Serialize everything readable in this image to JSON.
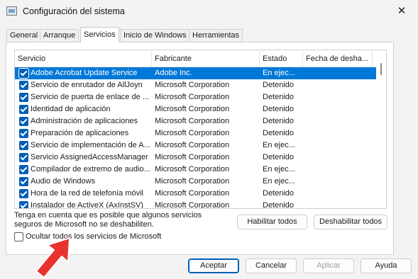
{
  "window": {
    "title": "Configuración del sistema",
    "close_glyph": "✕"
  },
  "tabs": [
    {
      "label": "General"
    },
    {
      "label": "Arranque"
    },
    {
      "label": "Servicios"
    },
    {
      "label": "Inicio de Windows"
    },
    {
      "label": "Herramientas"
    }
  ],
  "active_tab": "Servicios",
  "table": {
    "columns": [
      "Servicio",
      "Fabricante",
      "Estado",
      "Fecha de desha..."
    ],
    "rows": [
      {
        "service": "Adobe Acrobat Update Service",
        "manufacturer": "Adobe Inc.",
        "status": "En ejec...",
        "checked": true,
        "selected": true
      },
      {
        "service": "Servicio de enrutador de AllJoyn",
        "manufacturer": "Microsoft Corporation",
        "status": "Detenido",
        "checked": true
      },
      {
        "service": "Servicio de puerta de enlace de ...",
        "manufacturer": "Microsoft Corporation",
        "status": "Detenido",
        "checked": true
      },
      {
        "service": "Identidad de aplicación",
        "manufacturer": "Microsoft Corporation",
        "status": "Detenido",
        "checked": true
      },
      {
        "service": "Administración de aplicaciones",
        "manufacturer": "Microsoft Corporation",
        "status": "Detenido",
        "checked": true
      },
      {
        "service": "Preparación de aplicaciones",
        "manufacturer": "Microsoft Corporation",
        "status": "Detenido",
        "checked": true
      },
      {
        "service": "Servicio de implementación de A...",
        "manufacturer": "Microsoft Corporation",
        "status": "En ejec...",
        "checked": true
      },
      {
        "service": "Servicio AssignedAccessManager",
        "manufacturer": "Microsoft Corporation",
        "status": "Detenido",
        "checked": true
      },
      {
        "service": "Compilador de extremo de audio...",
        "manufacturer": "Microsoft Corporation",
        "status": "En ejec...",
        "checked": true
      },
      {
        "service": "Audio de Windows",
        "manufacturer": "Microsoft Corporation",
        "status": "En ejec...",
        "checked": true
      },
      {
        "service": "Hora de la red de telefonía móvil",
        "manufacturer": "Microsoft Corporation",
        "status": "Detenido",
        "checked": true
      },
      {
        "service": "Instalador de ActiveX (AxInstSV)",
        "manufacturer": "Microsoft Corporation",
        "status": "Detenido",
        "checked": true
      }
    ]
  },
  "note": {
    "line1": "Tenga en cuenta que es posible que algunos servicios",
    "line2": "seguros de Microsoft no se deshabiliten."
  },
  "hide_ms": {
    "label": "Ocultar todos los servicios de Microsoft",
    "checked": false
  },
  "buttons": {
    "enable_all": "Habilitar todos",
    "disable_all": "Deshabilitar todos",
    "accept": "Aceptar",
    "cancel": "Cancelar",
    "apply": "Aplicar",
    "help": "Ayuda"
  },
  "colors": {
    "accent": "#005fb8",
    "selection": "#0078d7",
    "annotation_arrow": "#e8322e"
  },
  "icons": {
    "app": "msconfig-icon",
    "close": "close-icon",
    "annotation": "red-arrow-icon"
  }
}
